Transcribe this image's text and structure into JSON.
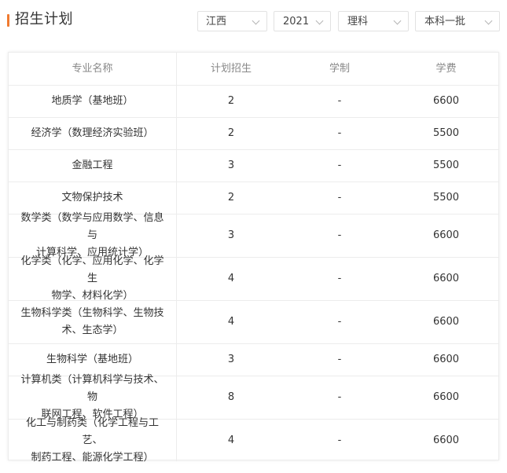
{
  "page": {
    "title": "招生计划",
    "accent_color": "#f07a30"
  },
  "filters": {
    "province": "江西",
    "year": "2021",
    "category": "理科",
    "batch": "本科一批"
  },
  "table": {
    "columns": [
      "专业名称",
      "计划招生",
      "学制",
      "学费"
    ],
    "rows": [
      {
        "major_lines": [
          "地质学（基地班）"
        ],
        "plan": "2",
        "duration": "-",
        "fee": "6600"
      },
      {
        "major_lines": [
          "经济学（数理经济实验班）"
        ],
        "plan": "2",
        "duration": "-",
        "fee": "5500"
      },
      {
        "major_lines": [
          "金融工程"
        ],
        "plan": "3",
        "duration": "-",
        "fee": "5500"
      },
      {
        "major_lines": [
          "文物保护技术"
        ],
        "plan": "2",
        "duration": "-",
        "fee": "5500"
      },
      {
        "major_lines": [
          "数学类（数学与应用数学、信息与",
          "计算科学、应用统计学）"
        ],
        "plan": "3",
        "duration": "-",
        "fee": "6600"
      },
      {
        "major_lines": [
          "化学类（化学、应用化学、化学生",
          "物学、材料化学）"
        ],
        "plan": "4",
        "duration": "-",
        "fee": "6600"
      },
      {
        "major_lines": [
          "生物科学类（生物科学、生物技",
          "术、生态学）"
        ],
        "plan": "4",
        "duration": "-",
        "fee": "6600"
      },
      {
        "major_lines": [
          "生物科学（基地班）"
        ],
        "plan": "3",
        "duration": "-",
        "fee": "6600"
      },
      {
        "major_lines": [
          "计算机类（计算机科学与技术、物",
          "联网工程、软件工程）"
        ],
        "plan": "8",
        "duration": "-",
        "fee": "6600"
      },
      {
        "major_lines": [
          "化工与制药类（化学工程与工艺、",
          "制药工程、能源化学工程）"
        ],
        "plan": "4",
        "duration": "-",
        "fee": "6600"
      }
    ]
  }
}
